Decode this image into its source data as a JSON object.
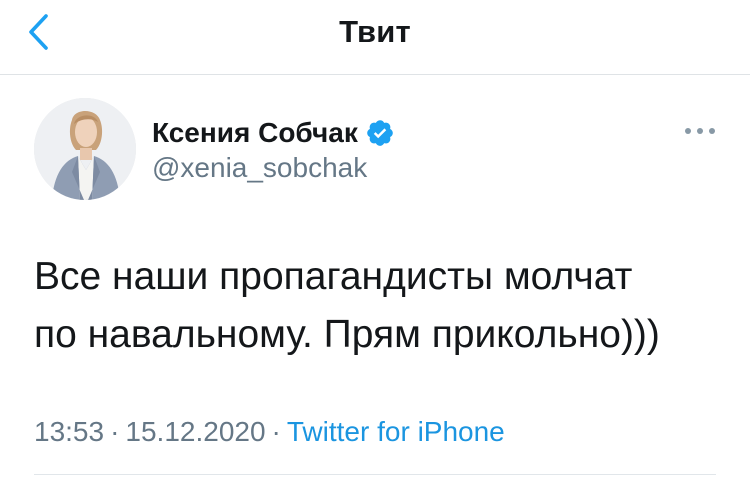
{
  "header": {
    "title": "Твит",
    "back_icon": "chevron-left-icon",
    "accent_color": "#1da1f2"
  },
  "tweet": {
    "author_name": "Ксения Собчак",
    "author_handle": "@xenia_sobchak",
    "verified": true,
    "verified_color": "#1da1f2",
    "text": "Все наши пропагандисты молчат\nпо навальному. Прям прикольно)))",
    "time": "13:53",
    "separator": "·",
    "date": "15.12.2020",
    "source": "Twitter for iPhone",
    "source_color": "#1b95e0"
  }
}
